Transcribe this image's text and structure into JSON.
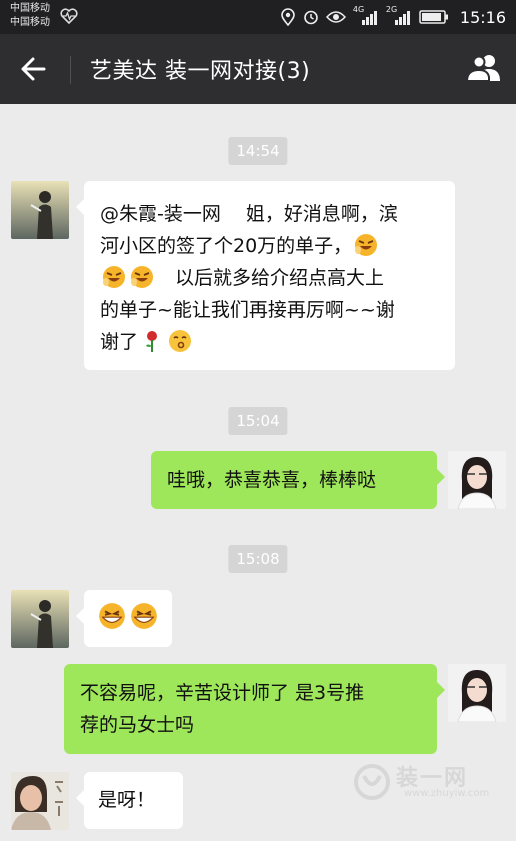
{
  "status": {
    "carrier1": "中国移动",
    "carrier2": "中国移动",
    "net1": "4G",
    "net2": "2G",
    "time": "15:16"
  },
  "header": {
    "title": "艺美达 装一网对接(3)"
  },
  "messages": {
    "t1": "14:54",
    "m1_line1": "@朱霞-装一网　 姐，好消息啊，滨",
    "m1_line2": "河小区的签了个20万的单子，",
    "m1_line3": "　以后就多给介绍点高大上",
    "m1_line4": "的单子~能让我们再接再厉啊~~谢",
    "m1_line5": "谢了",
    "t2": "15:04",
    "m2": "哇哦，恭喜恭喜，棒棒哒",
    "t3": "15:08",
    "m4_line1": "不容易呢，辛苦设计师了 是3号推",
    "m4_line2": "荐的马女士吗",
    "m5": "是呀！"
  },
  "watermark": {
    "text": "装一网",
    "url": "www.zhuyiw.com"
  },
  "colors": {
    "titlebar": "#2e2e31",
    "statusbar": "#202022",
    "chat_background": "#ebebeb",
    "sent_bubble": "#9ee65a",
    "received_bubble": "#ffffff"
  }
}
